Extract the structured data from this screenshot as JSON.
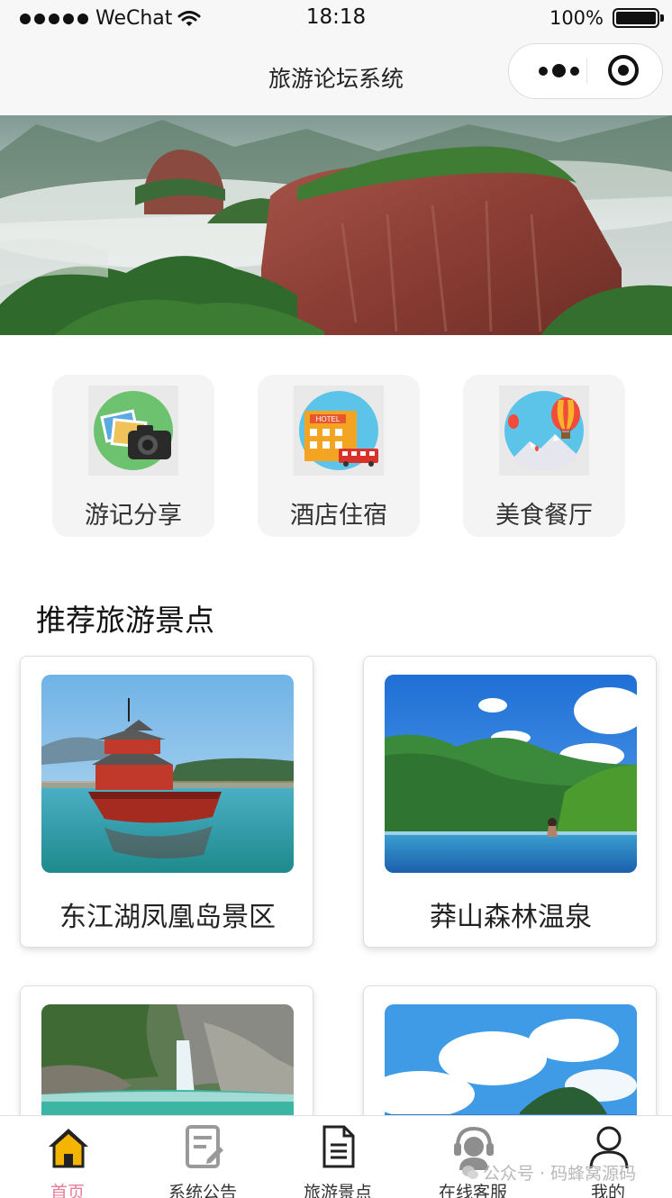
{
  "status_bar": {
    "carrier": "WeChat",
    "time": "18:18",
    "battery": "100%"
  },
  "nav": {
    "title": "旅游论坛系统"
  },
  "banner": {
    "slide_count": 2,
    "active_slide": 2
  },
  "categories": [
    {
      "label": "游记分享",
      "icon": "camera-photos-icon"
    },
    {
      "label": "酒店住宿",
      "icon": "hotel-icon"
    },
    {
      "label": "美食餐厅",
      "icon": "hot-air-balloon-icon"
    }
  ],
  "section": {
    "title": "推荐旅游景点"
  },
  "spots": [
    {
      "name": "东江湖凤凰岛景区"
    },
    {
      "name": "莽山森林温泉"
    },
    {
      "name": ""
    },
    {
      "name": ""
    }
  ],
  "tabs": [
    {
      "label": "首页",
      "icon": "home-icon",
      "active": true
    },
    {
      "label": "系统公告",
      "icon": "notice-icon",
      "active": false
    },
    {
      "label": "旅游景点",
      "icon": "document-icon",
      "active": false
    },
    {
      "label": "在线客服",
      "icon": "customer-service-icon",
      "active": false
    },
    {
      "label": "我的",
      "icon": "user-icon",
      "active": false
    }
  ],
  "watermark": "公众号 · 码蜂窝源码",
  "colors": {
    "active_tab": "#e87c9a",
    "home_icon": "#f4b400"
  }
}
